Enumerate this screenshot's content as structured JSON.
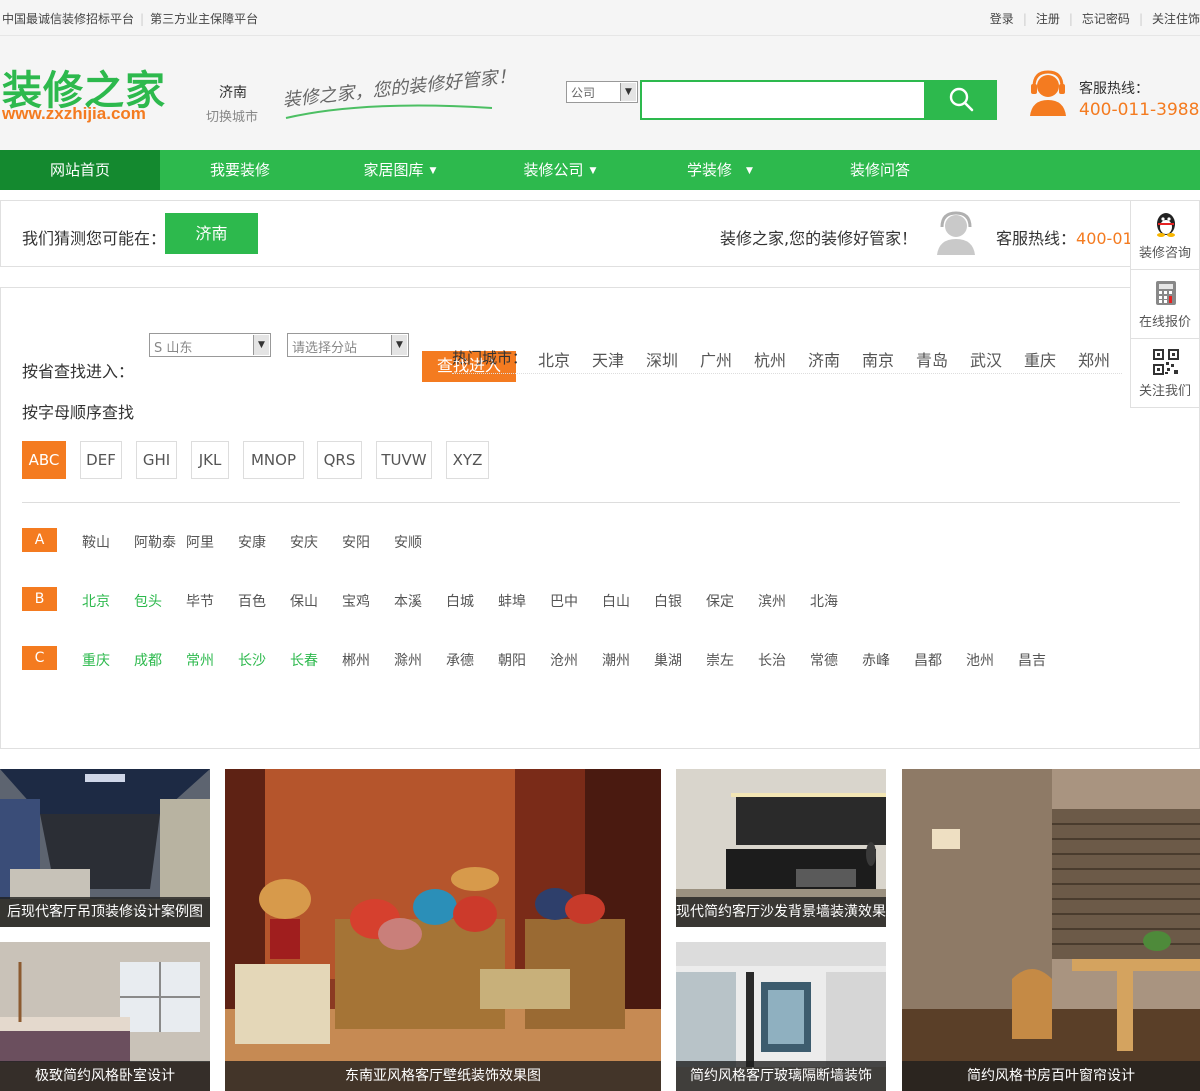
{
  "topbar": {
    "left_1": "中国最诚信装修招标平台",
    "left_2": "第三方业主保障平台",
    "login": "登录",
    "register": "注册",
    "forgot": "忘记密码",
    "follow": "关注住饰"
  },
  "header": {
    "logo_text": "装修之家",
    "logo_url": "www.zxzhijia.com",
    "city": "济南",
    "switch_city": "切换城市",
    "slogan": "装修之家，您的装修好管家！",
    "search_type": "公司",
    "search_placeholder": "",
    "hotline_label": "客服热线：",
    "hotline_number": "400-011-3988"
  },
  "nav": [
    {
      "label": "网站首页",
      "caret": ""
    },
    {
      "label": "我要装修",
      "caret": ""
    },
    {
      "label": "家居图库",
      "caret": "▼"
    },
    {
      "label": "装修公司",
      "caret": "▼"
    },
    {
      "label": "学装修",
      "caret": "▼"
    },
    {
      "label": "装修问答",
      "caret": ""
    }
  ],
  "guess": {
    "label": "我们猜测您可能在：",
    "city": "济南",
    "slogan": "装修之家,您的装修好管家！",
    "hotline_label": "客服热线：",
    "hotline_number": "400-011-3988"
  },
  "float_side": {
    "consult": "装修咨询",
    "quote": "在线报价",
    "follow": "关注我们"
  },
  "panel": {
    "province_label": "按省查找进入：",
    "province_select": "S 山东",
    "branch_select": "请选择分站",
    "find_button": "查找进入",
    "hot_label": "热门城市：",
    "hot_cities": [
      "北京",
      "天津",
      "深圳",
      "广州",
      "杭州",
      "济南",
      "南京",
      "青岛",
      "武汉",
      "重庆",
      "郑州"
    ],
    "alpha_label": "按字母顺序查找",
    "alpha_tabs": [
      "ABC",
      "DEF",
      "GHI",
      "JKL",
      "MNOP",
      "QRS",
      "TUVW",
      "XYZ"
    ],
    "groups": [
      {
        "letter": "A",
        "cities": [
          {
            "name": "鞍山",
            "hot": false
          },
          {
            "name": "阿勒泰",
            "hot": false
          },
          {
            "name": "阿里",
            "hot": false
          },
          {
            "name": "安康",
            "hot": false
          },
          {
            "name": "安庆",
            "hot": false
          },
          {
            "name": "安阳",
            "hot": false
          },
          {
            "name": "安顺",
            "hot": false
          }
        ]
      },
      {
        "letter": "B",
        "cities": [
          {
            "name": "北京",
            "hot": true
          },
          {
            "name": "包头",
            "hot": true
          },
          {
            "name": "毕节",
            "hot": false
          },
          {
            "name": "百色",
            "hot": false
          },
          {
            "name": "保山",
            "hot": false
          },
          {
            "name": "宝鸡",
            "hot": false
          },
          {
            "name": "本溪",
            "hot": false
          },
          {
            "name": "白城",
            "hot": false
          },
          {
            "name": "蚌埠",
            "hot": false
          },
          {
            "name": "巴中",
            "hot": false
          },
          {
            "name": "白山",
            "hot": false
          },
          {
            "name": "白银",
            "hot": false
          },
          {
            "name": "保定",
            "hot": false
          },
          {
            "name": "滨州",
            "hot": false
          },
          {
            "name": "北海",
            "hot": false
          }
        ]
      },
      {
        "letter": "C",
        "cities": [
          {
            "name": "重庆",
            "hot": true
          },
          {
            "name": "成都",
            "hot": true
          },
          {
            "name": "常州",
            "hot": true
          },
          {
            "name": "长沙",
            "hot": true
          },
          {
            "name": "长春",
            "hot": true
          },
          {
            "name": "郴州",
            "hot": false
          },
          {
            "name": "滁州",
            "hot": false
          },
          {
            "name": "承德",
            "hot": false
          },
          {
            "name": "朝阳",
            "hot": false
          },
          {
            "name": "沧州",
            "hot": false
          },
          {
            "name": "潮州",
            "hot": false
          },
          {
            "name": "巢湖",
            "hot": false
          },
          {
            "name": "崇左",
            "hot": false
          },
          {
            "name": "长治",
            "hot": false
          },
          {
            "name": "常德",
            "hot": false
          },
          {
            "name": "赤峰",
            "hot": false
          },
          {
            "name": "昌都",
            "hot": false
          },
          {
            "name": "池州",
            "hot": false
          },
          {
            "name": "昌吉",
            "hot": false
          }
        ]
      }
    ]
  },
  "gallery": [
    {
      "caption": "后现代客厅吊顶装修设计案例图"
    },
    {
      "caption": "东南亚风格客厅壁纸装饰效果图"
    },
    {
      "caption": "现代简约客厅沙发背景墙装潢效果"
    },
    {
      "caption": "简约风格书房百叶窗帘设计"
    },
    {
      "caption": "极致简约风格卧室设计"
    },
    {
      "caption": "简约风格客厅玻璃隔断墙装饰"
    }
  ],
  "colors": {
    "brand_green": "#2db94d",
    "nav_active": "#14892f",
    "accent_orange": "#f47b20"
  }
}
